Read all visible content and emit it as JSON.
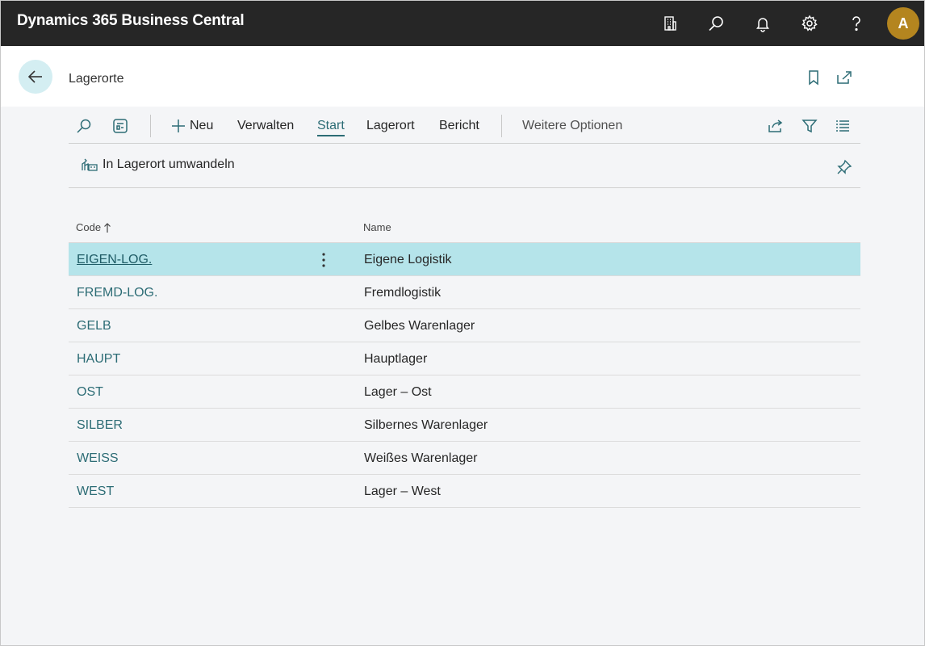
{
  "app": {
    "title": "Dynamics 365 Business Central",
    "avatar_initial": "A"
  },
  "topbar_icons": [
    "building-icon",
    "search-icon",
    "bell-icon",
    "gear-icon",
    "help-icon"
  ],
  "page": {
    "title": "Lagerorte"
  },
  "actionbar": {
    "new_label": "Neu",
    "items": [
      "Verwalten",
      "Start",
      "Lagerort",
      "Bericht"
    ],
    "active": "Start",
    "more_label": "Weitere Optionen"
  },
  "subbar": {
    "action_label": "In Lagerort umwandeln"
  },
  "table": {
    "columns": {
      "code": "Code",
      "name": "Name"
    },
    "rows": [
      {
        "code": "EIGEN-LOG.",
        "name": "Eigene Logistik",
        "selected": true
      },
      {
        "code": "FREMD-LOG.",
        "name": "Fremdlogistik"
      },
      {
        "code": "GELB",
        "name": "Gelbes Warenlager"
      },
      {
        "code": "HAUPT",
        "name": "Hauptlager"
      },
      {
        "code": "OST",
        "name": "Lager – Ost"
      },
      {
        "code": "SILBER",
        "name": "Silbernes Warenlager"
      },
      {
        "code": "WEISS",
        "name": "Weißes Warenlager"
      },
      {
        "code": "WEST",
        "name": "Lager – West"
      }
    ]
  },
  "colors": {
    "topbar": "#262626",
    "accent": "#2c6c75",
    "selected_row": "#b5e4ea",
    "avatar": "#b4851f"
  }
}
